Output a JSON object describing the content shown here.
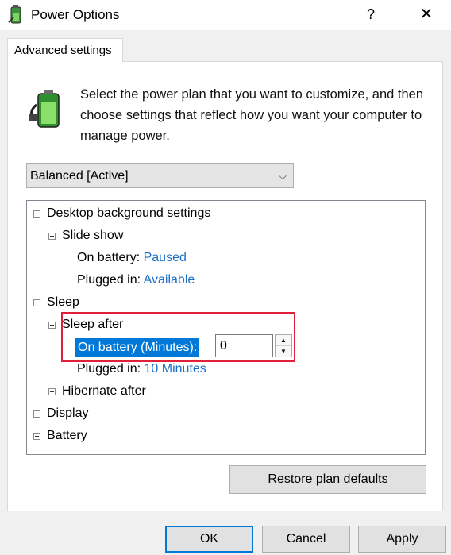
{
  "window": {
    "title": "Power Options",
    "help_label": "?",
    "close_label": "✕",
    "icon": "power-plug-icon"
  },
  "tab": {
    "label": "Advanced settings"
  },
  "description": "Select the power plan that you want to customize, and then choose settings that reflect how you want your computer to manage power.",
  "plan_select": {
    "value": "Balanced [Active]",
    "icon": "chevron-down-icon"
  },
  "tree": {
    "desktop_background": "Desktop background settings",
    "slide_show": "Slide show",
    "slide_on_battery_label": "On battery:",
    "slide_on_battery_value": "Paused",
    "slide_plugged_label": "Plugged in:",
    "slide_plugged_value": "Available",
    "sleep": "Sleep",
    "sleep_after": "Sleep after",
    "sleep_on_battery_label": "On battery (Minutes):",
    "sleep_on_battery_value": "0",
    "sleep_plugged_label": "Plugged in:",
    "sleep_plugged_value": "10 Minutes",
    "hibernate_after": "Hibernate after",
    "display": "Display",
    "battery": "Battery"
  },
  "buttons": {
    "restore": "Restore plan defaults",
    "ok": "OK",
    "cancel": "Cancel",
    "apply": "Apply"
  },
  "colors": {
    "selection": "#0078d7",
    "value_link": "#1a6fc4",
    "highlight_box": "#e0203a"
  }
}
